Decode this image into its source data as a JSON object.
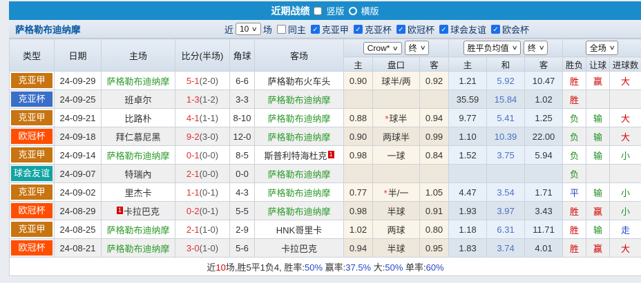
{
  "topbar": {
    "title": "近期战绩",
    "options": [
      {
        "label": "竖版",
        "selected": true
      },
      {
        "label": "横版",
        "selected": false
      }
    ]
  },
  "filter": {
    "team": "萨格勒布迪纳摩",
    "near_label": "近",
    "match_count": "10",
    "unit_label": "场",
    "same_home": {
      "label": "同主",
      "checked": false
    },
    "leagues": [
      {
        "label": "克亚甲",
        "checked": true
      },
      {
        "label": "克亚杯",
        "checked": true
      },
      {
        "label": "欧冠杯",
        "checked": true
      },
      {
        "label": "球会友谊",
        "checked": true
      },
      {
        "label": "欧会杯",
        "checked": true
      }
    ]
  },
  "table": {
    "headers_left": [
      "类型",
      "日期",
      "主场",
      "比分(半场)",
      "角球",
      "客场"
    ],
    "dropdowns": {
      "asia_source": "Crow*",
      "asia_state": "终",
      "europe_source": "胜平负均值",
      "europe_state": "终",
      "scope": "全场"
    },
    "subheaders": [
      "主",
      "盘口",
      "客",
      "主",
      "和",
      "客",
      "胜负",
      "让球",
      "进球数"
    ],
    "rows": [
      {
        "league": "克亚甲",
        "league_color": "#c77411",
        "date": "24-09-29",
        "home": {
          "name": "萨格勒布迪纳摩",
          "green": true,
          "badge": "",
          "badge_pos": ""
        },
        "score": "5-1",
        "half": "(2-0)",
        "corner": "6-6",
        "away": {
          "name": "萨格勒布火车头",
          "green": false,
          "badge": "",
          "badge_pos": ""
        },
        "asia": {
          "home": "0.90",
          "line": "球半/两",
          "star": false,
          "away": "0.92"
        },
        "europe": {
          "home": "1.21",
          "draw": "5.92",
          "away": "10.47"
        },
        "result": {
          "text": "胜",
          "color": "red"
        },
        "let": {
          "text": "赢",
          "color": "red"
        },
        "goals": {
          "text": "大",
          "color": "red"
        }
      },
      {
        "league": "克亚杯",
        "league_color": "#3a6fc8",
        "date": "24-09-25",
        "home": {
          "name": "班卓尔",
          "green": false,
          "badge": "",
          "badge_pos": ""
        },
        "score": "1-3",
        "half": "(1-2)",
        "corner": "3-3",
        "away": {
          "name": "萨格勒布迪纳摩",
          "green": true,
          "badge": "",
          "badge_pos": ""
        },
        "asia": {
          "home": "",
          "line": "",
          "star": false,
          "away": ""
        },
        "europe": {
          "home": "35.59",
          "draw": "15.84",
          "away": "1.02"
        },
        "result": {
          "text": "胜",
          "color": "red"
        },
        "let": {
          "text": "",
          "color": "dark"
        },
        "goals": {
          "text": "",
          "color": "dark"
        }
      },
      {
        "league": "克亚甲",
        "league_color": "#c77411",
        "date": "24-09-21",
        "home": {
          "name": "比路朴",
          "green": false,
          "badge": "",
          "badge_pos": ""
        },
        "score": "4-1",
        "half": "(1-1)",
        "corner": "8-10",
        "away": {
          "name": "萨格勒布迪纳摩",
          "green": true,
          "badge": "",
          "badge_pos": ""
        },
        "asia": {
          "home": "0.88",
          "line": "球半",
          "star": true,
          "away": "0.94"
        },
        "europe": {
          "home": "9.77",
          "draw": "5.41",
          "away": "1.25"
        },
        "result": {
          "text": "负",
          "color": "green"
        },
        "let": {
          "text": "输",
          "color": "green"
        },
        "goals": {
          "text": "大",
          "color": "red"
        }
      },
      {
        "league": "欧冠杯",
        "league_color": "#ff4e00",
        "date": "24-09-18",
        "home": {
          "name": "拜仁慕尼黑",
          "green": false,
          "badge": "",
          "badge_pos": ""
        },
        "score": "9-2",
        "half": "(3-0)",
        "corner": "12-0",
        "away": {
          "name": "萨格勒布迪纳摩",
          "green": true,
          "badge": "",
          "badge_pos": ""
        },
        "asia": {
          "home": "0.90",
          "line": "两球半",
          "star": false,
          "away": "0.99"
        },
        "europe": {
          "home": "1.10",
          "draw": "10.39",
          "away": "22.00"
        },
        "result": {
          "text": "负",
          "color": "green"
        },
        "let": {
          "text": "输",
          "color": "green"
        },
        "goals": {
          "text": "大",
          "color": "red"
        }
      },
      {
        "league": "克亚甲",
        "league_color": "#c77411",
        "date": "24-09-14",
        "home": {
          "name": "萨格勒布迪纳摩",
          "green": true,
          "badge": "",
          "badge_pos": ""
        },
        "score": "0-1",
        "half": "(0-0)",
        "corner": "8-5",
        "away": {
          "name": "斯普利特海杜克",
          "green": false,
          "badge": "1",
          "badge_pos": "after"
        },
        "asia": {
          "home": "0.98",
          "line": "一球",
          "star": false,
          "away": "0.84"
        },
        "europe": {
          "home": "1.52",
          "draw": "3.75",
          "away": "5.94"
        },
        "result": {
          "text": "负",
          "color": "green"
        },
        "let": {
          "text": "输",
          "color": "green"
        },
        "goals": {
          "text": "小",
          "color": "green"
        }
      },
      {
        "league": "球会友谊",
        "league_color": "#12a3a3",
        "date": "24-09-07",
        "home": {
          "name": "特瑞內",
          "green": false,
          "badge": "",
          "badge_pos": ""
        },
        "score": "2-1",
        "half": "(0-0)",
        "corner": "0-0",
        "away": {
          "name": "萨格勒布迪纳摩",
          "green": true,
          "badge": "",
          "badge_pos": ""
        },
        "asia": {
          "home": "",
          "line": "",
          "star": false,
          "away": ""
        },
        "europe": {
          "home": "",
          "draw": "",
          "away": ""
        },
        "result": {
          "text": "负",
          "color": "green"
        },
        "let": {
          "text": "",
          "color": "dark"
        },
        "goals": {
          "text": "",
          "color": "dark"
        }
      },
      {
        "league": "克亚甲",
        "league_color": "#c77411",
        "date": "24-09-02",
        "home": {
          "name": "里杰卡",
          "green": false,
          "badge": "",
          "badge_pos": ""
        },
        "score": "1-1",
        "half": "(0-1)",
        "corner": "4-3",
        "away": {
          "name": "萨格勒布迪纳摩",
          "green": true,
          "badge": "",
          "badge_pos": ""
        },
        "asia": {
          "home": "0.77",
          "line": "半/一",
          "star": true,
          "away": "1.05"
        },
        "europe": {
          "home": "4.47",
          "draw": "3.54",
          "away": "1.71"
        },
        "result": {
          "text": "平",
          "color": "blue"
        },
        "let": {
          "text": "输",
          "color": "green"
        },
        "goals": {
          "text": "小",
          "color": "green"
        }
      },
      {
        "league": "欧冠杯",
        "league_color": "#ff4e00",
        "date": "24-08-29",
        "home": {
          "name": "卡拉巴克",
          "green": false,
          "badge": "1",
          "badge_pos": "before"
        },
        "score": "0-2",
        "half": "(0-1)",
        "corner": "5-5",
        "away": {
          "name": "萨格勒布迪纳摩",
          "green": true,
          "badge": "",
          "badge_pos": ""
        },
        "asia": {
          "home": "0.98",
          "line": "半球",
          "star": false,
          "away": "0.91"
        },
        "europe": {
          "home": "1.93",
          "draw": "3.97",
          "away": "3.43"
        },
        "result": {
          "text": "胜",
          "color": "red"
        },
        "let": {
          "text": "赢",
          "color": "red"
        },
        "goals": {
          "text": "小",
          "color": "green"
        }
      },
      {
        "league": "克亚甲",
        "league_color": "#c77411",
        "date": "24-08-25",
        "home": {
          "name": "萨格勒布迪纳摩",
          "green": true,
          "badge": "",
          "badge_pos": ""
        },
        "score": "2-1",
        "half": "(1-0)",
        "corner": "2-9",
        "away": {
          "name": "HNK哥里卡",
          "green": false,
          "badge": "",
          "badge_pos": ""
        },
        "asia": {
          "home": "1.02",
          "line": "两球",
          "star": false,
          "away": "0.80"
        },
        "europe": {
          "home": "1.18",
          "draw": "6.31",
          "away": "11.71"
        },
        "result": {
          "text": "胜",
          "color": "red"
        },
        "let": {
          "text": "输",
          "color": "green"
        },
        "goals": {
          "text": "走",
          "color": "blue"
        }
      },
      {
        "league": "欧冠杯",
        "league_color": "#ff4e00",
        "date": "24-08-21",
        "home": {
          "name": "萨格勒布迪纳摩",
          "green": true,
          "badge": "",
          "badge_pos": ""
        },
        "score": "3-0",
        "half": "(1-0)",
        "corner": "5-6",
        "away": {
          "name": "卡拉巴克",
          "green": false,
          "badge": "",
          "badge_pos": ""
        },
        "asia": {
          "home": "0.94",
          "line": "半球",
          "star": false,
          "away": "0.95"
        },
        "europe": {
          "home": "1.83",
          "draw": "3.74",
          "away": "4.01"
        },
        "result": {
          "text": "胜",
          "color": "red"
        },
        "let": {
          "text": "赢",
          "color": "red"
        },
        "goals": {
          "text": "大",
          "color": "red"
        }
      }
    ]
  },
  "footer": {
    "segments": [
      {
        "text": "近",
        "color": "dark"
      },
      {
        "text": "10",
        "color": "red"
      },
      {
        "text": "场,胜5平1负4, 胜率:",
        "color": "dark"
      },
      {
        "text": "50%",
        "color": "blue"
      },
      {
        "text": " 赢率:",
        "color": "dark"
      },
      {
        "text": "37.5%",
        "color": "blue"
      },
      {
        "text": " 大:",
        "color": "dark"
      },
      {
        "text": "50%",
        "color": "blue"
      },
      {
        "text": " 单率:",
        "color": "dark"
      },
      {
        "text": "60%",
        "color": "blue"
      }
    ]
  }
}
